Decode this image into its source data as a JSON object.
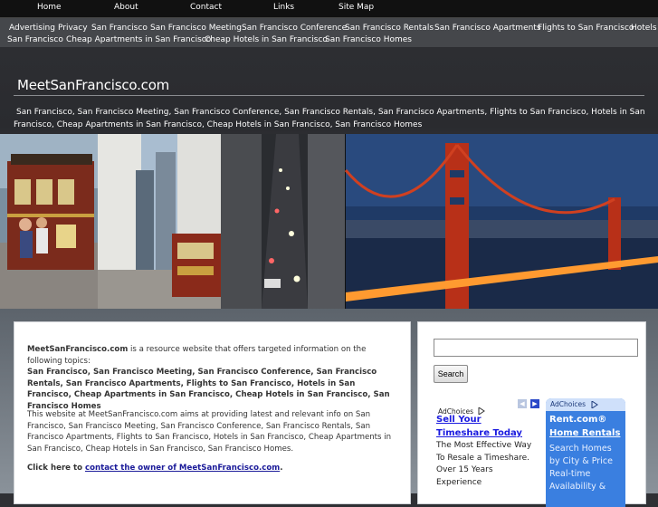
{
  "top_nav": [
    "Home",
    "About",
    "Contact",
    "Links",
    "Site Map"
  ],
  "link_bar": [
    "Advertising",
    "Privacy",
    "San Francisco",
    "San Francisco Meeting",
    "San Francisco Conference",
    "San Francisco Rentals",
    "San Francisco Apartments",
    "Flights to San Francisco",
    "Hotels in",
    "San Francisco",
    "Cheap Apartments in San Francisco",
    "Cheap Hotels in San Francisco",
    "San Francisco Homes"
  ],
  "header": {
    "site_title": "MeetSanFrancisco.com",
    "keywords": "San Francisco, San Francisco Meeting, San Francisco Conference, San Francisco Rentals, San Francisco Apartments, Flights to San Francisco, Hotels in San Francisco, Cheap Apartments in San Francisco, Cheap Hotels in San Francisco, San Francisco Homes"
  },
  "main": {
    "intro_site": "MeetSanFrancisco.com",
    "intro_text": " is a resource website that offers targeted information on the following topics:",
    "topics": "San Francisco, San Francisco Meeting, San Francisco Conference, San Francisco Rentals, San Francisco Apartments, Flights to San Francisco, Hotels in San Francisco, Cheap Apartments in San Francisco, Cheap Hotels in San Francisco, San Francisco Homes",
    "aims": "This website at MeetSanFrancisco.com aims at providing latest and relevant info on San Francisco, San Francisco Meeting, San Francisco Conference, San Francisco Rentals, San Francisco Apartments, Flights to San Francisco, Hotels in San Francisco, Cheap Apartments in San Francisco, Cheap Hotels in San Francisco, San Francisco Homes.",
    "click_prefix": "Click here to ",
    "contact_link": "contact the owner of MeetSanFrancisco.com",
    "click_suffix": "."
  },
  "sidebar": {
    "search_value": "",
    "search_button": "Search",
    "ad1": {
      "adchoices": "AdChoices",
      "title": "Sell Your Timeshare Today",
      "body": "The Most Effective Way To Resale a Timeshare. Over 15 Years Experience"
    },
    "ad2": {
      "adchoices": "AdChoices",
      "brand": "Rent.com®",
      "title": "Home Rentals",
      "body": "Search Homes by City & Price Real-time Availability &"
    }
  },
  "icons": {
    "adchoices": "adchoices-triangle-icon",
    "prev": "chevron-left-icon",
    "next": "chevron-right-icon"
  },
  "colors": {
    "link_blue": "#1a1adf",
    "ad_blue": "#3a7fe0",
    "nav_bg": "#111111"
  }
}
